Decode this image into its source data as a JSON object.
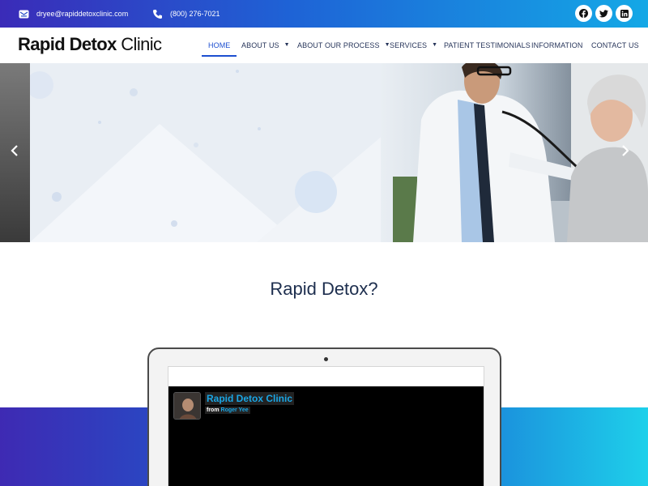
{
  "topbar": {
    "email": "dryee@rapiddetoxclinic.com",
    "phone": "(800) 276-7021",
    "social": [
      {
        "icon": "facebook-icon"
      },
      {
        "icon": "twitter-icon"
      },
      {
        "icon": "linkedin-icon"
      }
    ]
  },
  "header": {
    "logo_bold": "Rapid Detox",
    "logo_light": "Clinic"
  },
  "nav": {
    "items": [
      {
        "label": "HOME",
        "active": true
      },
      {
        "label": "ABOUT US",
        "dropdown": true
      },
      {
        "label": "ABOUT OUR PROCESS",
        "dropdown": true
      },
      {
        "label": "SERVICES",
        "dropdown": true
      },
      {
        "label": "PATIENT TESTIMONIALS"
      },
      {
        "label": "INFORMATION"
      },
      {
        "label": "CONTACT US"
      }
    ]
  },
  "hero": {
    "prev_icon": "chevron-left-icon",
    "next_icon": "chevron-right-icon"
  },
  "section": {
    "title": "Rapid Detox?"
  },
  "video": {
    "title": "Rapid Detox Clinic",
    "from_label": "from",
    "author": "Roger Yee"
  },
  "colors": {
    "accent": "#1d4fd0",
    "nav_text": "#27355a",
    "title_text": "#1d2e4e",
    "video_link": "#1aa7e6"
  }
}
